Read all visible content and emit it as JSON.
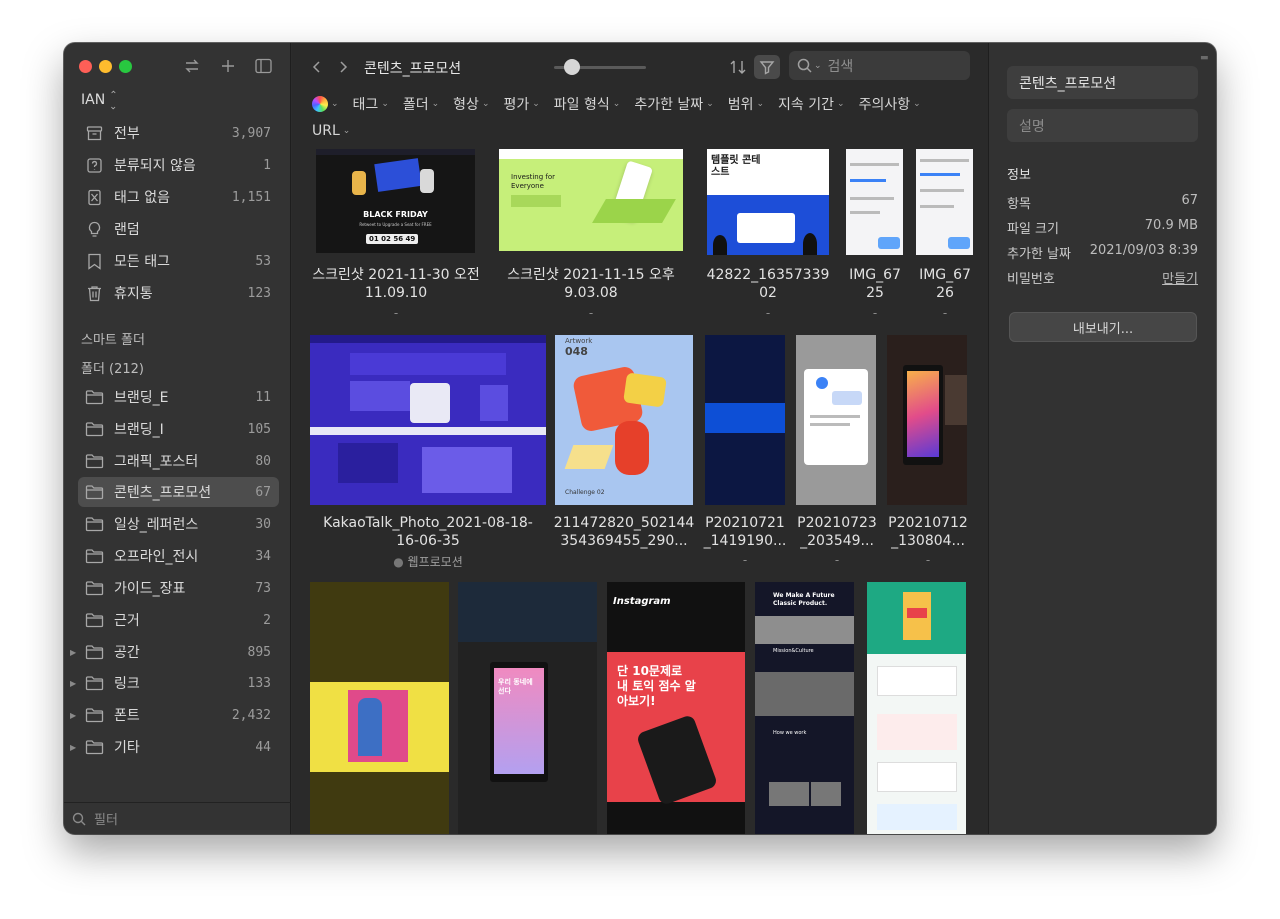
{
  "sidebar": {
    "library": "IAN",
    "items": [
      {
        "label": "전부",
        "count": "3,907",
        "icon": "archive-icon"
      },
      {
        "label": "분류되지 않음",
        "count": "1",
        "icon": "unsorted-icon"
      },
      {
        "label": "태그 없음",
        "count": "1,151",
        "icon": "no-tag-icon"
      },
      {
        "label": "랜덤",
        "count": "",
        "icon": "lightbulb-icon"
      },
      {
        "label": "모든 태그",
        "count": "53",
        "icon": "tag-icon"
      },
      {
        "label": "휴지통",
        "count": "123",
        "icon": "trash-icon"
      }
    ],
    "smart_folders": "스마트 폴더",
    "folders_header": "폴더 (212)",
    "folders": [
      {
        "label": "브랜딩_E",
        "count": "11",
        "expandable": false
      },
      {
        "label": "브랜딩_I",
        "count": "105",
        "expandable": false
      },
      {
        "label": "그래픽_포스터",
        "count": "80",
        "expandable": false
      },
      {
        "label": "콘텐츠_프로모션",
        "count": "67",
        "expandable": false,
        "selected": true
      },
      {
        "label": "일상_레퍼런스",
        "count": "30",
        "expandable": false
      },
      {
        "label": "오프라인_전시",
        "count": "34",
        "expandable": false
      },
      {
        "label": "가이드_장표",
        "count": "73",
        "expandable": false
      },
      {
        "label": "근거",
        "count": "2",
        "expandable": false
      },
      {
        "label": "공간",
        "count": "895",
        "expandable": true
      },
      {
        "label": "링크",
        "count": "133",
        "expandable": true
      },
      {
        "label": "폰트",
        "count": "2,432",
        "expandable": true
      },
      {
        "label": "기타",
        "count": "44",
        "expandable": true
      }
    ],
    "filter_placeholder": "필터"
  },
  "toolbar": {
    "title": "콘텐츠_프로모션",
    "search_placeholder": "검색"
  },
  "filters": [
    "태그",
    "폴더",
    "형상",
    "평가",
    "파일 형식",
    "추가한 날짜",
    "범위",
    "지속 기간",
    "주의사항",
    "URL"
  ],
  "grid": {
    "row1": [
      {
        "name1": "스크린샷 2021-11-30 오전",
        "name2": "11.09.10",
        "sub": "-"
      },
      {
        "name1": "스크린샷 2021-11-15 오후",
        "name2": "9.03.08",
        "sub": "-"
      },
      {
        "name1": "42822_16357339",
        "name2": "02",
        "sub": "-"
      },
      {
        "name1": "IMG_67",
        "name2": "25",
        "sub": "-"
      },
      {
        "name1": "IMG_67",
        "name2": "26",
        "sub": "-"
      }
    ],
    "row2": [
      {
        "name1": "KakaoTalk_Photo_2021-08-18-",
        "name2": "16-06-35",
        "sub": "웹프로모션"
      },
      {
        "name1": "211472820_502144",
        "name2": "354369455_290...",
        "sub": ""
      },
      {
        "name1": "P20210721",
        "name2": "_1419190...",
        "sub": "-"
      },
      {
        "name1": "P20210723",
        "name2": "_203549...",
        "sub": "-"
      },
      {
        "name1": "P20210712",
        "name2": "_130804...",
        "sub": "-"
      }
    ],
    "thumb_text": {
      "black_friday": "BLACK FRIDAY",
      "black_friday_sub": "Retweet to Upgrade a Seat for FREE",
      "timer": "01 02 56 49",
      "investing": "Investing for Everyone",
      "template_title": "템플릿 콘테스트",
      "artwork": "Artwork",
      "artwork_num": "048",
      "challenge": "Challenge 02",
      "instagram": "Instagram",
      "quiz": "단 10문제로 내 토익 점수 알아보기!",
      "future": "We Make A Future Classic Product.",
      "mission": "Mission&Culture",
      "how": "How we work",
      "ad_text": "우리 동네에 선다"
    }
  },
  "inspector": {
    "name": "콘텐츠_프로모션",
    "desc_placeholder": "설명",
    "info_header": "정보",
    "rows": [
      {
        "label": "항목",
        "value": "67"
      },
      {
        "label": "파일 크기",
        "value": "70.9 MB"
      },
      {
        "label": "추가한 날짜",
        "value": "2021/09/03 8:39"
      },
      {
        "label": "비밀번호",
        "value": "만들기"
      }
    ],
    "export": "내보내기..."
  },
  "colors": {
    "accent": "#4d4d4d",
    "bg": "#2a2a2a"
  }
}
